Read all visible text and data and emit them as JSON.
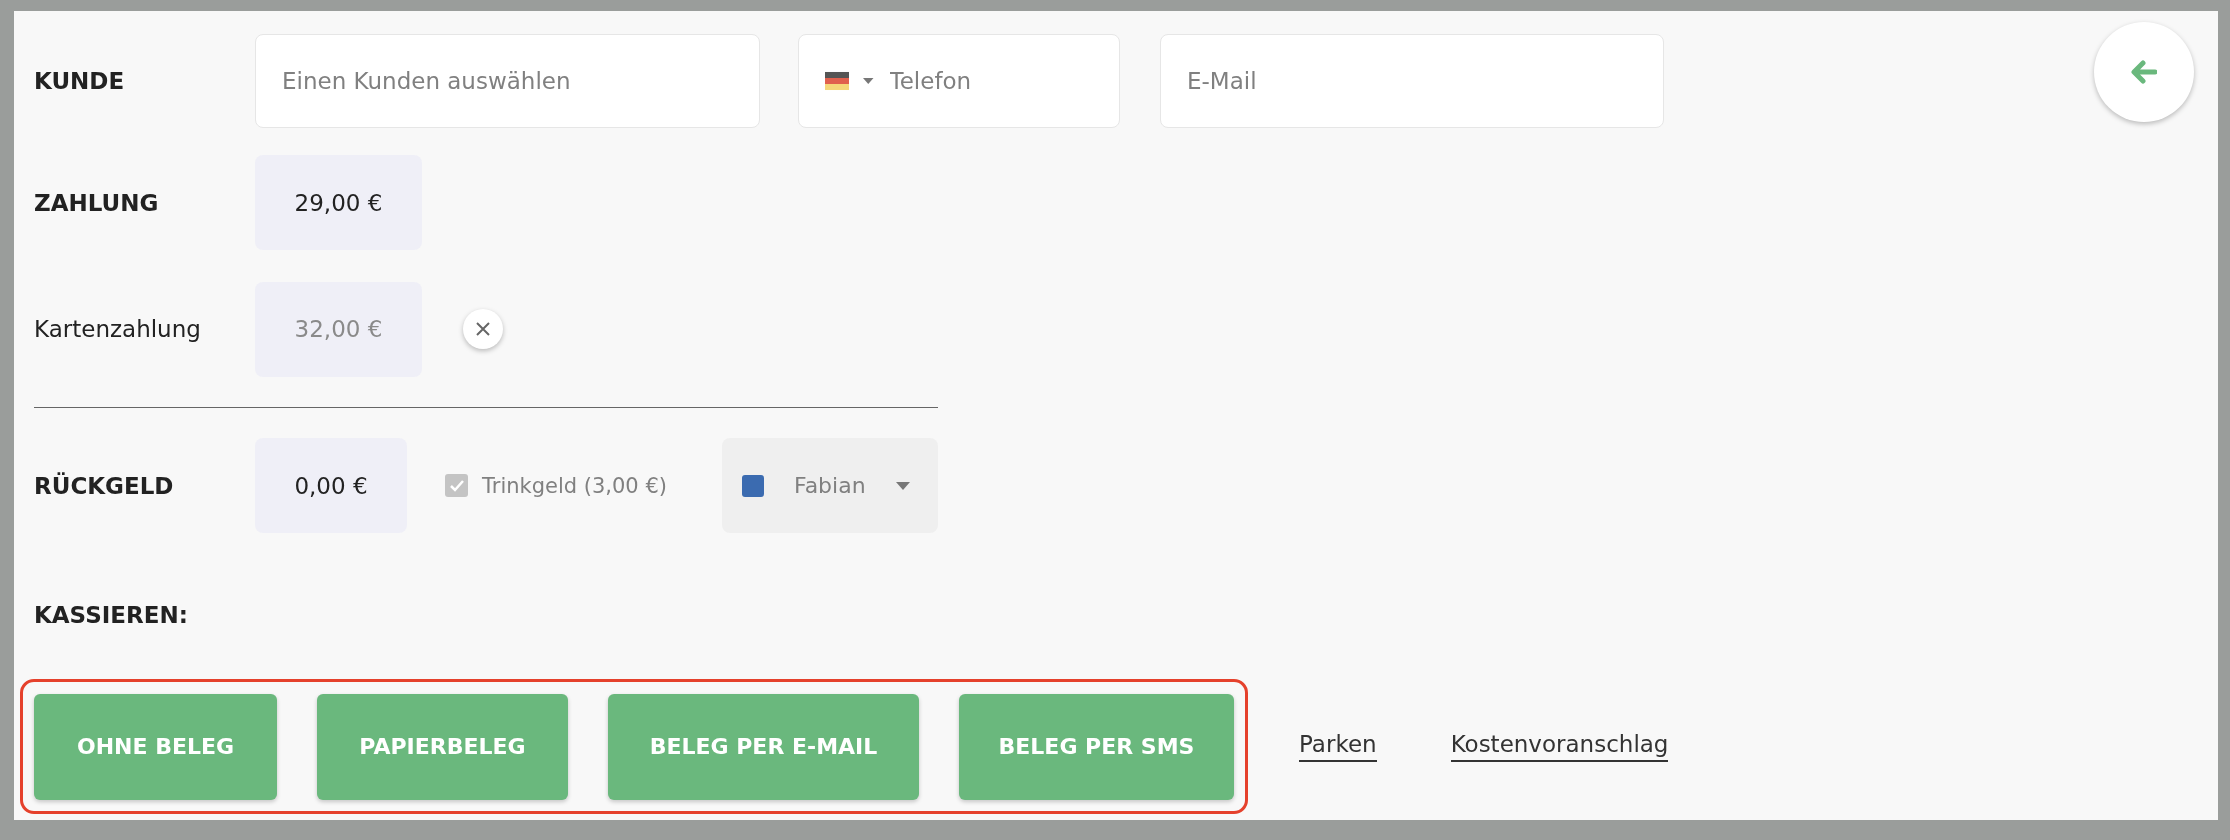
{
  "customer": {
    "label": "KUNDE",
    "search_placeholder": "Einen Kunden auswählen",
    "phone_placeholder": "Telefon",
    "email_placeholder": "E-Mail"
  },
  "payment": {
    "label": "ZAHLUNG",
    "amount": "29,00 €"
  },
  "card_payment": {
    "label": "Kartenzahlung",
    "amount": "32,00 €"
  },
  "change": {
    "label": "RÜCKGELD",
    "amount": "0,00 €",
    "tip": {
      "label": "Trinkgeld (3,00 €)",
      "checked": true
    },
    "staff": {
      "name": "Fabian",
      "color": "#3b6bb0"
    }
  },
  "checkout": {
    "label": "KASSIEREN:",
    "buttons": [
      "OHNE BELEG",
      "PAPIERBELEG",
      "BELEG PER E-MAIL",
      "BELEG PER SMS"
    ],
    "links": [
      "Parken",
      "Kostenvoranschlag"
    ]
  }
}
